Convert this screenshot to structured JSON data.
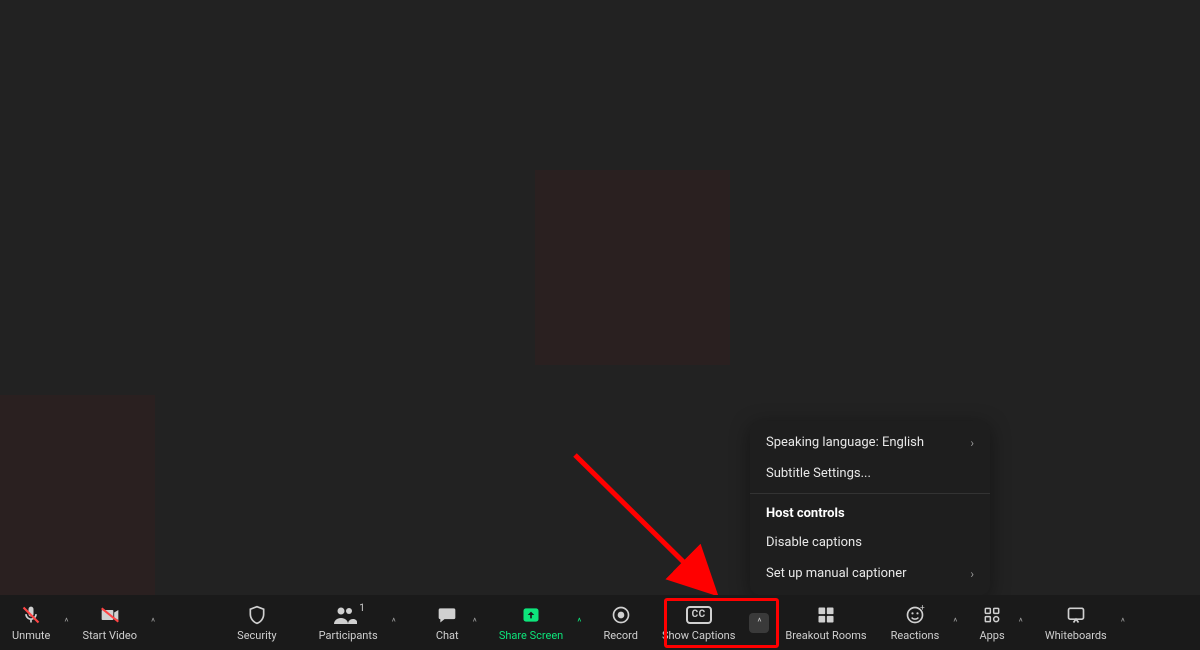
{
  "toolbar": {
    "unmute": "Unmute",
    "start_video": "Start Video",
    "security": "Security",
    "participants": "Participants",
    "participants_count": "1",
    "chat": "Chat",
    "share_screen": "Share Screen",
    "record": "Record",
    "show_captions": "Show Captions",
    "breakout_rooms": "Breakout Rooms",
    "reactions": "Reactions",
    "apps": "Apps",
    "whiteboards": "Whiteboards",
    "cc_label": "CC"
  },
  "captions_menu": {
    "speaking_language": "Speaking language: English",
    "subtitle_settings": "Subtitle Settings...",
    "host_controls_header": "Host controls",
    "disable_captions": "Disable captions",
    "setup_manual": "Set up manual captioner"
  },
  "colors": {
    "accent_green": "#0de57b",
    "annotation_red": "#ff0000",
    "bg": "#222222",
    "toolbar_bg": "#1a1a1a"
  }
}
